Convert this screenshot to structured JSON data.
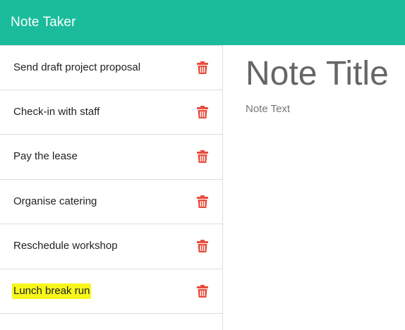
{
  "navbar": {
    "brand": "Note Taker"
  },
  "notes": [
    {
      "title": "Send draft project proposal",
      "delete_icon": "trash-icon"
    },
    {
      "title": "Check-in with staff",
      "delete_icon": "trash-icon"
    },
    {
      "title": "Pay the lease",
      "delete_icon": "trash-icon"
    },
    {
      "title": "Organise catering",
      "delete_icon": "trash-icon"
    },
    {
      "title": "Reschedule workshop",
      "delete_icon": "trash-icon"
    },
    {
      "title": "Lunch break run",
      "delete_icon": "trash-icon",
      "highlighted": true
    }
  ],
  "editor": {
    "title_placeholder": "Note Title",
    "text_placeholder": "Note Text"
  },
  "colors": {
    "navbar": "#1abc9c",
    "delete_icon": "#e74c3c",
    "highlight": "#f6f61a"
  }
}
